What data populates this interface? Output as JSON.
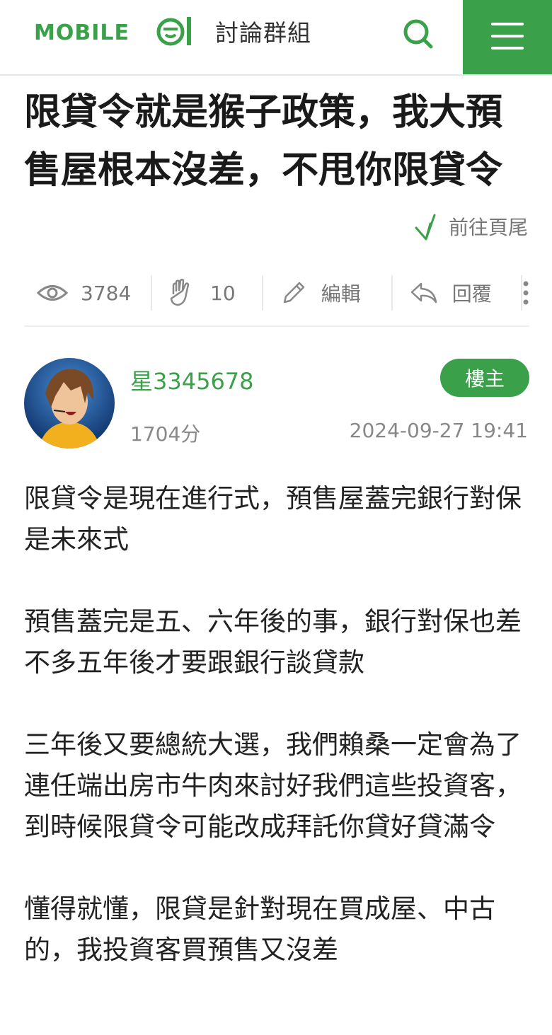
{
  "header": {
    "logo_text": "MOBILE01",
    "section_title": "討論群組",
    "colors": {
      "brand": "#3aa14a"
    }
  },
  "post": {
    "title": "限貸令就是猴子政策，我大預售屋根本沒差，不甩你限貸令",
    "goto_end_label": "前往頁尾",
    "stats": {
      "views": "3784",
      "likes": "10",
      "edit_label": "編輯",
      "reply_label": "回覆"
    },
    "author": {
      "name": "星3345678",
      "score": "1704分",
      "badge": "樓主",
      "timestamp": "2024-09-27 19:41"
    },
    "paragraphs": [
      "限貸令是現在進行式，預售屋蓋完銀行對保是未來式",
      "預售蓋完是五、六年後的事，銀行對保也差不多五年後才要跟銀行談貸款",
      "三年後又要總統大選，我們賴桑一定會為了連任端出房市牛肉來討好我們這些投資客， 到時候限貸令可能改成拜託你貸好貸滿令",
      "懂得就懂，限貸是針對現在買成屋、中古的，我投資客買預售又沒差"
    ]
  }
}
